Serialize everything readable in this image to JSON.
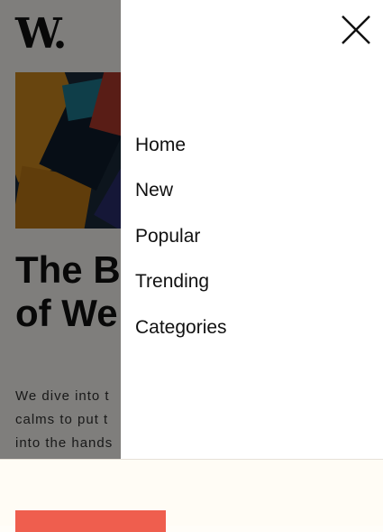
{
  "site": {
    "logo_text": "W."
  },
  "article": {
    "title_visible": "The B\nof We",
    "excerpt_visible": "We dive into t\ncalms to put t\ninto the hands\nfulfilling its pr"
  },
  "menu": {
    "items": [
      {
        "label": "Home"
      },
      {
        "label": "New"
      },
      {
        "label": "Popular"
      },
      {
        "label": "Trending"
      },
      {
        "label": "Categories"
      }
    ]
  },
  "icons": {
    "close": "close-icon"
  },
  "colors": {
    "accent": "#ef5e4e",
    "overlay": "rgba(0,0,0,0.5)",
    "drawer_bg": "#ffffff",
    "page_bg": "#fffdf8"
  }
}
